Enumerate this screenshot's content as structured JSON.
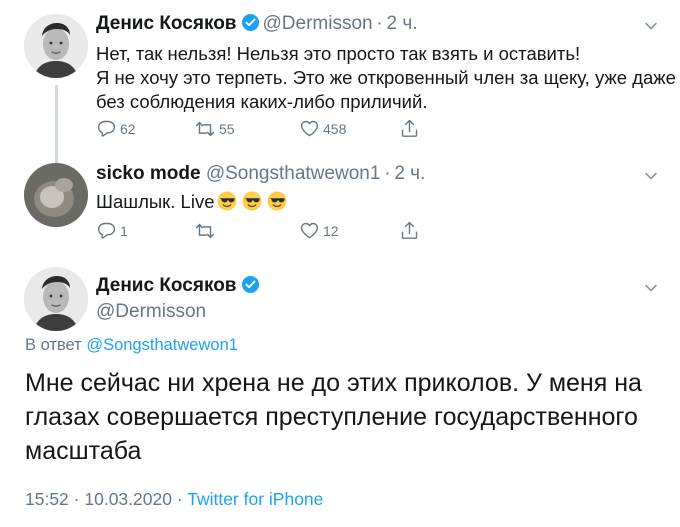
{
  "tweets": [
    {
      "name": "Денис Косяков",
      "handle": "@Dermisson",
      "time": "2 ч.",
      "lines": [
        "Нет, так нельзя! Нельзя это просто так взять и оставить!",
        "Я не хочу это терпеть. Это же откровенный член за щеку, уже даже",
        "без соблюдения каких-либо приличий."
      ],
      "reply_count": "62",
      "retweet_count": "55",
      "like_count": "458"
    },
    {
      "name": "sicko mode",
      "handle": "@Songsthatwewon1",
      "time": "2 ч.",
      "text": "Шашлык. Live",
      "reply_count": "1",
      "retweet_count": "",
      "like_count": "12"
    }
  ],
  "main_tweet": {
    "name": "Денис Косяков",
    "handle": "@Dermisson",
    "reply_to_prefix": "В ответ",
    "reply_to_handle": "@Songsthatwewon1",
    "text": "Мне сейчас ни хрена не до этих приколов. У меня на глазах совершается преступление государственного масштаба",
    "time": "15:52",
    "date": "10.03.2020",
    "source": "Twitter for iPhone"
  },
  "separator": "·",
  "colors": {
    "accent": "#1da1f2",
    "secondary_text": "#657786",
    "primary_text": "#14171a",
    "thread_line": "#cfd9de"
  },
  "icons": [
    "verified-badge-icon",
    "reply-icon",
    "retweet-icon",
    "like-icon",
    "share-icon",
    "chevron-down-icon",
    "cool-emoji-icon"
  ]
}
